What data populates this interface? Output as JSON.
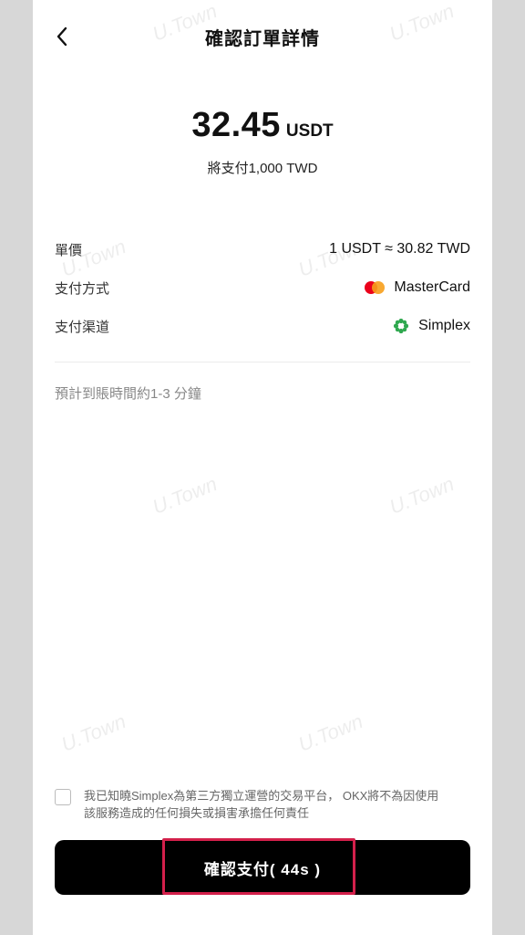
{
  "header": {
    "title": "確認訂單詳情",
    "back_icon": "chevron-left-icon"
  },
  "summary": {
    "amount": "32.45",
    "unit": "USDT",
    "pay_note": "將支付1,000 TWD"
  },
  "details": [
    {
      "label": "單價",
      "value": "1 USDT ≈ 30.82 TWD",
      "icon": ""
    },
    {
      "label": "支付方式",
      "value": "MasterCard",
      "icon": "mastercard-icon"
    },
    {
      "label": "支付渠道",
      "value": "Simplex",
      "icon": "simplex-icon"
    }
  ],
  "eta": "預計到賬時間約1-3 分鐘",
  "consent": {
    "checked": false,
    "text_line1": "我已知曉Simplex為第三方獨立運營的交易平台， OKX將不為因使用",
    "text_line2": "該服務造成的任何損失或損害承擔任何責任"
  },
  "confirm_button": {
    "label": "確認支付( 44s )"
  },
  "watermark": "U.Town",
  "colors": {
    "button_bg": "#000000",
    "highlight": "#d3204b",
    "mastercard_red": "#eb001b",
    "mastercard_orange": "#f79e1b",
    "simplex_green": "#2fa84f"
  }
}
